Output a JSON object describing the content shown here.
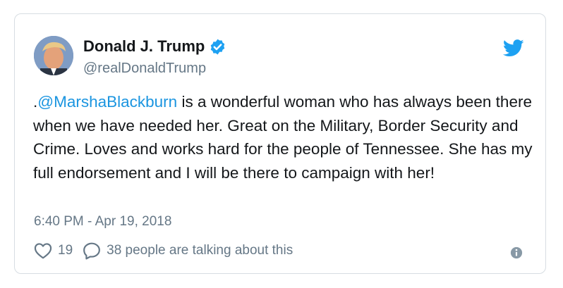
{
  "author": {
    "name": "Donald J. Trump",
    "handle": "@realDonaldTrump",
    "verified": true
  },
  "tweet": {
    "prefix": ".",
    "mention": "@MarshaBlackburn",
    "text": " is a wonderful woman who has always been there when we have needed her. Great on the Military, Border Security and Crime. Loves and works hard for the people of Tennessee. She has my full endorsement and I will be there to campaign with her!",
    "timestamp": "6:40 PM - Apr 19, 2018"
  },
  "actions": {
    "likes": "19",
    "talking": "38 people are talking about this"
  },
  "icons": {
    "brand": "twitter-bird-icon",
    "verified": "verified-badge-icon",
    "like": "heart-icon",
    "reply": "speech-bubble-icon",
    "info": "info-icon"
  },
  "colors": {
    "brand_blue": "#1da1f2",
    "mention_blue": "#1b95e0",
    "muted": "#657786",
    "text": "#14171a"
  }
}
